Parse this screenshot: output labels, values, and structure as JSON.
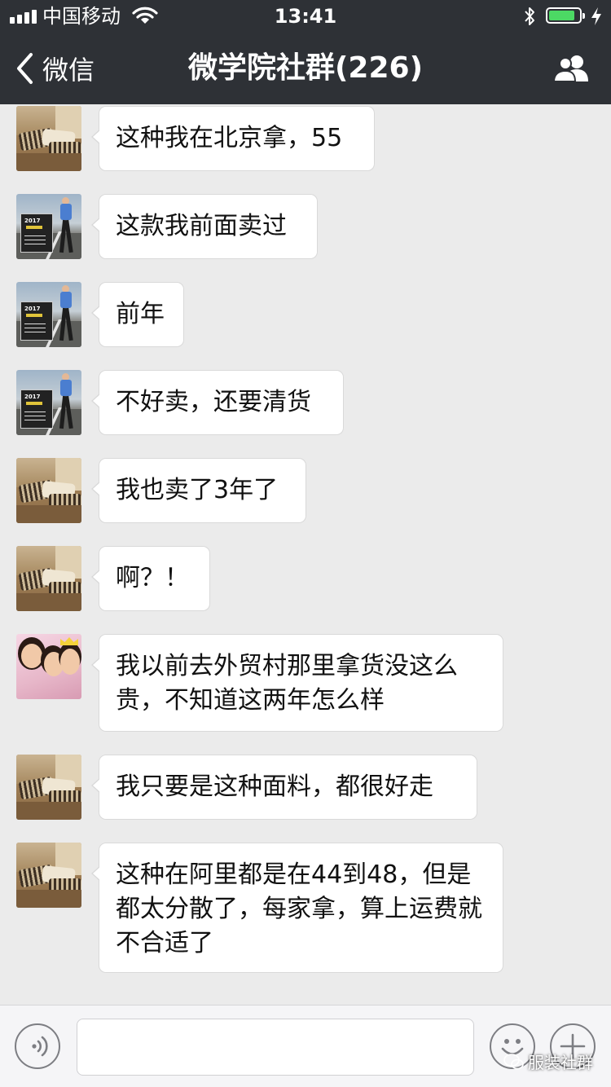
{
  "status_bar": {
    "carrier": "中国移动",
    "time": "13:41",
    "battery_level": 0.85,
    "icons": [
      "signal-icon",
      "wifi-icon",
      "bluetooth-icon",
      "battery-icon",
      "charging-icon"
    ]
  },
  "nav": {
    "back_label": "微信",
    "title": "微学院社群(226)",
    "right_icon": "group-members-icon"
  },
  "messages": [
    {
      "avatar": "bedroom",
      "text": "这种我在北京拿，55"
    },
    {
      "avatar": "runner",
      "text": "这款我前面卖过"
    },
    {
      "avatar": "runner",
      "text": "前年"
    },
    {
      "avatar": "runner",
      "text": "不好卖，还要清货"
    },
    {
      "avatar": "bedroom",
      "text": "我也卖了3年了"
    },
    {
      "avatar": "bedroom",
      "text": "啊？！"
    },
    {
      "avatar": "kids",
      "text": "我以前去外贸村那里拿货没这么贵，不知道这两年怎么样"
    },
    {
      "avatar": "bedroom",
      "text": "我只要是这种面料，都很好走"
    },
    {
      "avatar": "bedroom",
      "text": "这种在阿里都是在44到48，但是都太分散了，每家拿，算上运费就不合适了"
    }
  ],
  "input_bar": {
    "voice_icon": "voice-icon",
    "text_value": "",
    "emoji_icon": "emoji-icon",
    "more_icon": "plus-icon"
  },
  "watermark": "服装社群",
  "colors": {
    "nav_bg": "#2e3136",
    "chat_bg": "#ebebeb",
    "bubble_bg": "#ffffff",
    "battery_fill": "#4cd964"
  }
}
